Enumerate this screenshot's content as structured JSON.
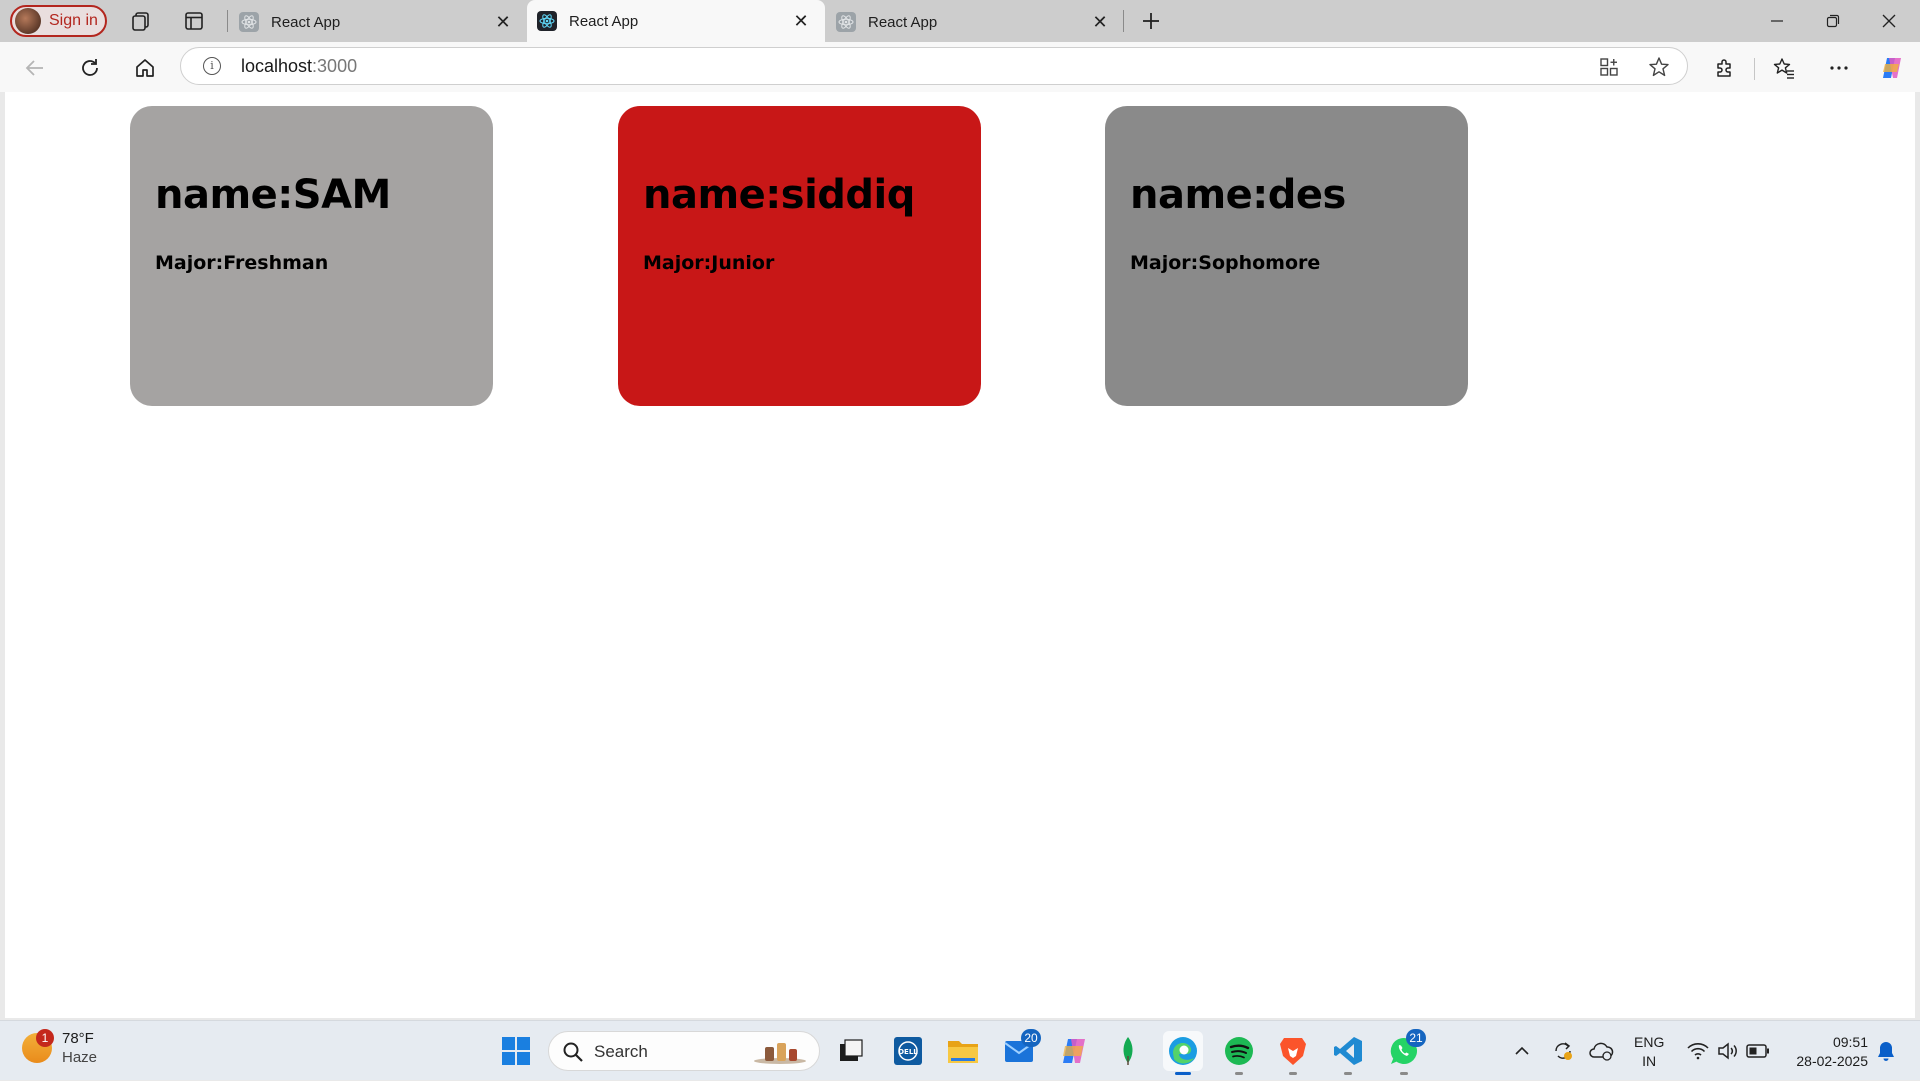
{
  "browser": {
    "signin_label": "Sign in",
    "tabs": [
      {
        "title": "React App",
        "active": false
      },
      {
        "title": "React App",
        "active": true
      },
      {
        "title": "React App",
        "active": false
      }
    ],
    "address": {
      "host": "localhost",
      "port": ":3000"
    }
  },
  "page": {
    "cards": [
      {
        "name": "name:SAM",
        "major": "Major:Freshman",
        "color": "#a5a3a2"
      },
      {
        "name": "name:siddiq",
        "major": "Major:Junior",
        "color": "#c81717"
      },
      {
        "name": "name:des",
        "major": "Major:Sophomore",
        "color": "#8a8a8a"
      }
    ]
  },
  "taskbar": {
    "weather": {
      "temp": "78°F",
      "condition": "Haze",
      "badge": "1"
    },
    "search_label": "Search",
    "badges": {
      "mail": "20",
      "whatsapp": "21"
    },
    "language": {
      "line1": "ENG",
      "line2": "IN"
    },
    "clock": {
      "time": "09:51",
      "date": "28-02-2025"
    }
  }
}
